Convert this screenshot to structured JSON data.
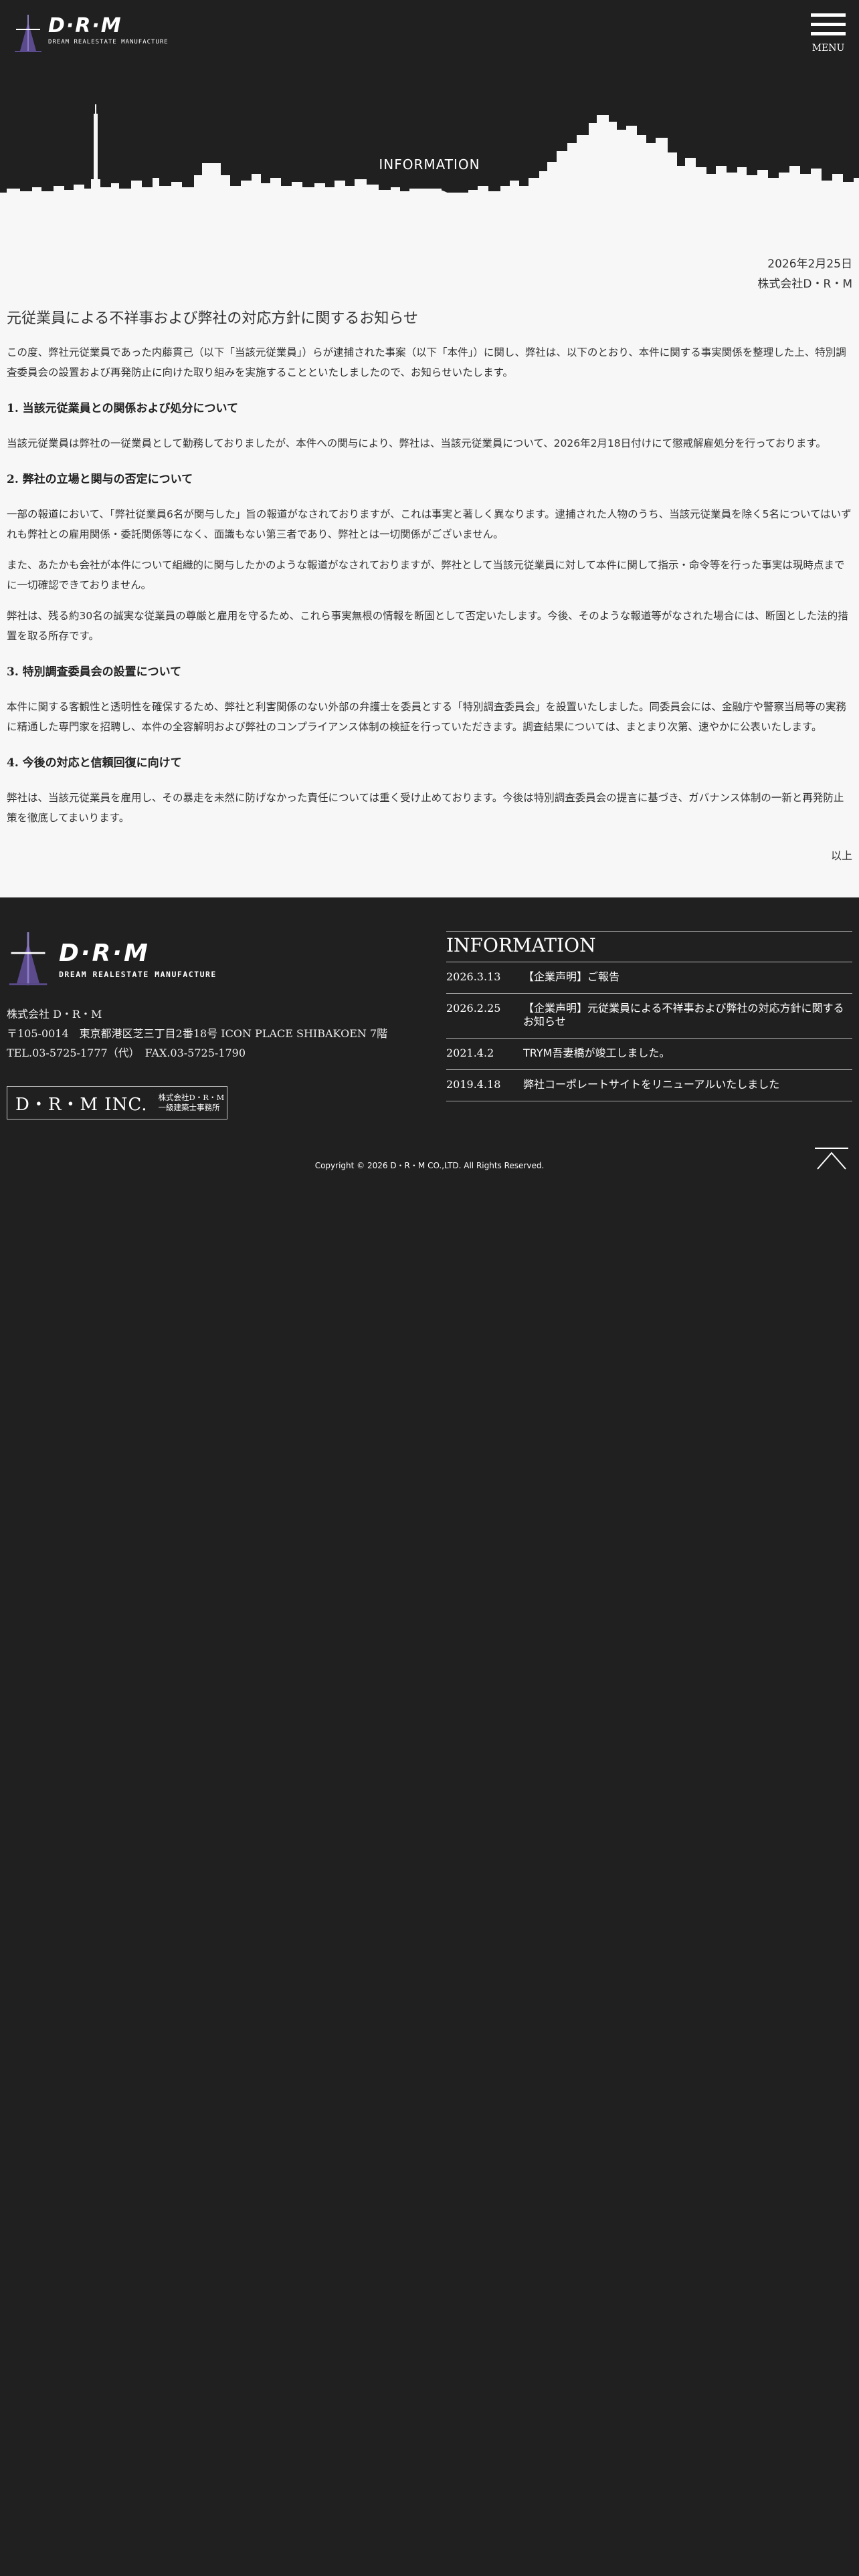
{
  "header": {
    "brand_name": "D·R·M",
    "brand_tagline": "DREAM REALESTATE MANUFACTURE",
    "menu_label": "MENU"
  },
  "hero": {
    "title": "INFORMATION"
  },
  "article": {
    "date": "2026年2月25日",
    "company": "株式会社D・R・M",
    "title": "元従業員による不祥事および弊社の対応方針に関するお知らせ",
    "intro": "この度、弊社元従業員であった内藤貫己（以下「当該元従業員」）らが逮捕された事案（以下「本件」）に関し、弊社は、以下のとおり、本件に関する事実関係を整理した上、特別調査委員会の設置および再発防止に向けた取り組みを実施することといたしましたので、お知らせいたします。",
    "sections": [
      {
        "heading": "1. 当該元従業員との関係および処分について",
        "paragraphs": [
          "当該元従業員は弊社の一従業員として勤務しておりましたが、本件への関与により、弊社は、当該元従業員について、2026年2月18日付けにて懲戒解雇処分を行っております。"
        ]
      },
      {
        "heading": "2. 弊社の立場と関与の否定について",
        "paragraphs": [
          "一部の報道において、「弊社従業員6名が関与した」旨の報道がなされておりますが、これは事実と著しく異なります。逮捕された人物のうち、当該元従業員を除く5名についてはいずれも弊社との雇用関係・委託関係等になく、面識もない第三者であり、弊社とは一切関係がございません。",
          "また、あたかも会社が本件について組織的に関与したかのような報道がなされておりますが、弊社として当該元従業員に対して本件に関して指示・命令等を行った事実は現時点までに一切確認できておりません。",
          "弊社は、残る約30名の誠実な従業員の尊厳と雇用を守るため、これら事実無根の情報を断固として否定いたします。今後、そのような報道等がなされた場合には、断固とした法的措置を取る所存です。"
        ]
      },
      {
        "heading": "3. 特別調査委員会の設置について",
        "paragraphs": [
          "本件に関する客観性と透明性を確保するため、弊社と利害関係のない外部の弁護士を委員とする「特別調査委員会」を設置いたしました。同委員会には、金融庁や警察当局等の実務に精通した専門家を招聘し、本件の全容解明および弊社のコンプライアンス体制の検証を行っていただきます。調査結果については、まとまり次第、速やかに公表いたします。"
        ]
      },
      {
        "heading": "4. 今後の対応と信頼回復に向けて",
        "paragraphs": [
          "弊社は、当該元従業員を雇用し、その暴走を未然に防げなかった責任については重く受け止めております。今後は特別調査委員会の提言に基づき、ガバナンス体制の一新と再発防止策を徹底してまいります。"
        ]
      }
    ],
    "closing": "以上"
  },
  "footer": {
    "brand_name": "D·R·M",
    "brand_tagline": "DREAM REALESTATE MANUFACTURE",
    "company": "株式会社 D・R・M",
    "address": "〒105-0014　東京都港区芝三丁目2番18号 ICON PLACE SHIBAKOEN 7階",
    "phone": "TEL.03-5725-1777（代）　FAX.03-5725-1790",
    "badge_name": "D・R・M INC.",
    "badge_sub1": "株式会社D・R・M",
    "badge_sub2": "一級建築士事務所",
    "info_title": "INFORMATION",
    "news": [
      {
        "date": "2026.3.13",
        "text": "【企業声明】ご報告"
      },
      {
        "date": "2026.2.25",
        "text": "【企業声明】元従業員による不祥事および弊社の対応方針に関するお知らせ"
      },
      {
        "date": "2021.4.2",
        "text": "TRYM吾妻橋が竣工しました。"
      },
      {
        "date": "2019.4.18",
        "text": "弊社コーポレートサイトをリニューアルいたしました"
      }
    ],
    "copyright": "Copyright © 2026 D・R・M CO.,LTD. All Rights Reserved."
  },
  "colors": {
    "background": "#1f1f1f",
    "article_bg": "#f7f7f7",
    "logo_accent": "#5b4a8c"
  }
}
